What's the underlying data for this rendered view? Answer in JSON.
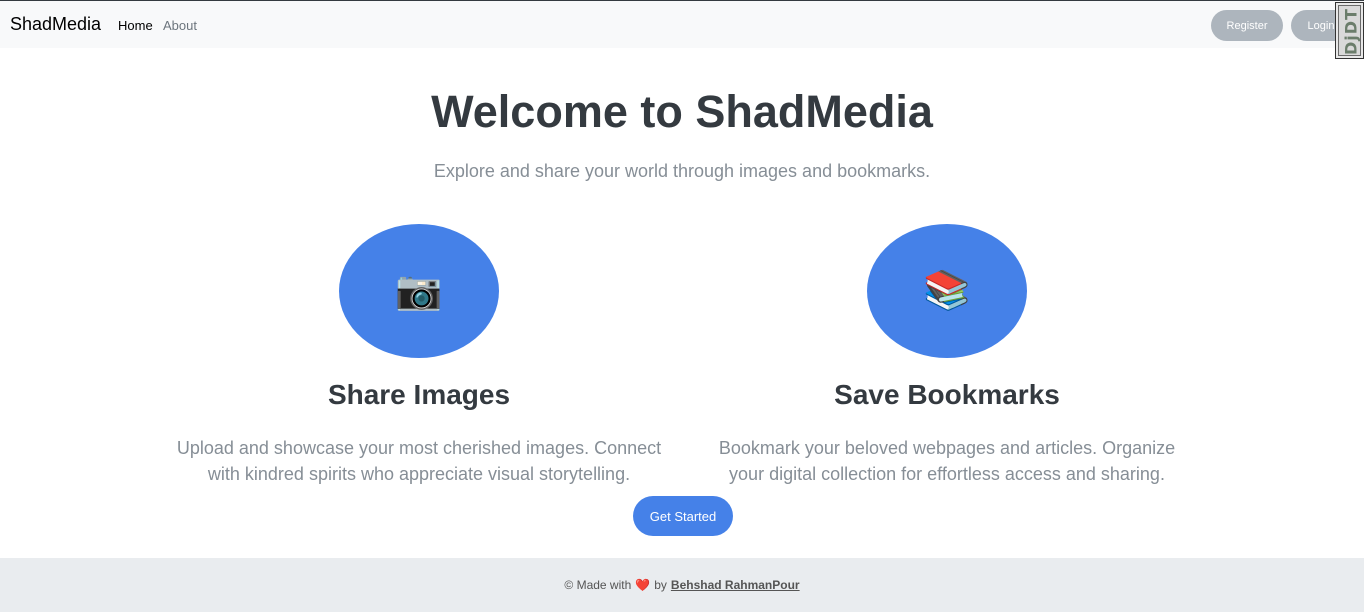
{
  "navbar": {
    "brand": "ShadMedia",
    "links": [
      {
        "label": "Home"
      },
      {
        "label": "About"
      }
    ],
    "register_label": "Register",
    "login_label": "Login",
    "debug_toolbar_label": "DjDT"
  },
  "hero": {
    "title": "Welcome to ShadMedia",
    "subtitle": "Explore and share your world through images and bookmarks."
  },
  "features": [
    {
      "icon": "📷",
      "icon_name": "camera-icon",
      "title": "Share Images",
      "description": "Upload and showcase your most cherished images. Connect with kindred spirits who appreciate visual storytelling."
    },
    {
      "icon": "📚",
      "icon_name": "books-icon",
      "title": "Save Bookmarks",
      "description": "Bookmark your beloved webpages and articles. Organize your digital collection for effortless access and sharing."
    }
  ],
  "cta": {
    "label": "Get Started"
  },
  "footer": {
    "prefix": "© Made with",
    "heart": "❤️",
    "by": "by",
    "author": "Behshad RahmanPour"
  },
  "colors": {
    "accent": "#4581e8",
    "nav_button": "#adb5bd",
    "footer_bg": "#e9ecef",
    "navbar_bg": "#f8f9fa"
  }
}
